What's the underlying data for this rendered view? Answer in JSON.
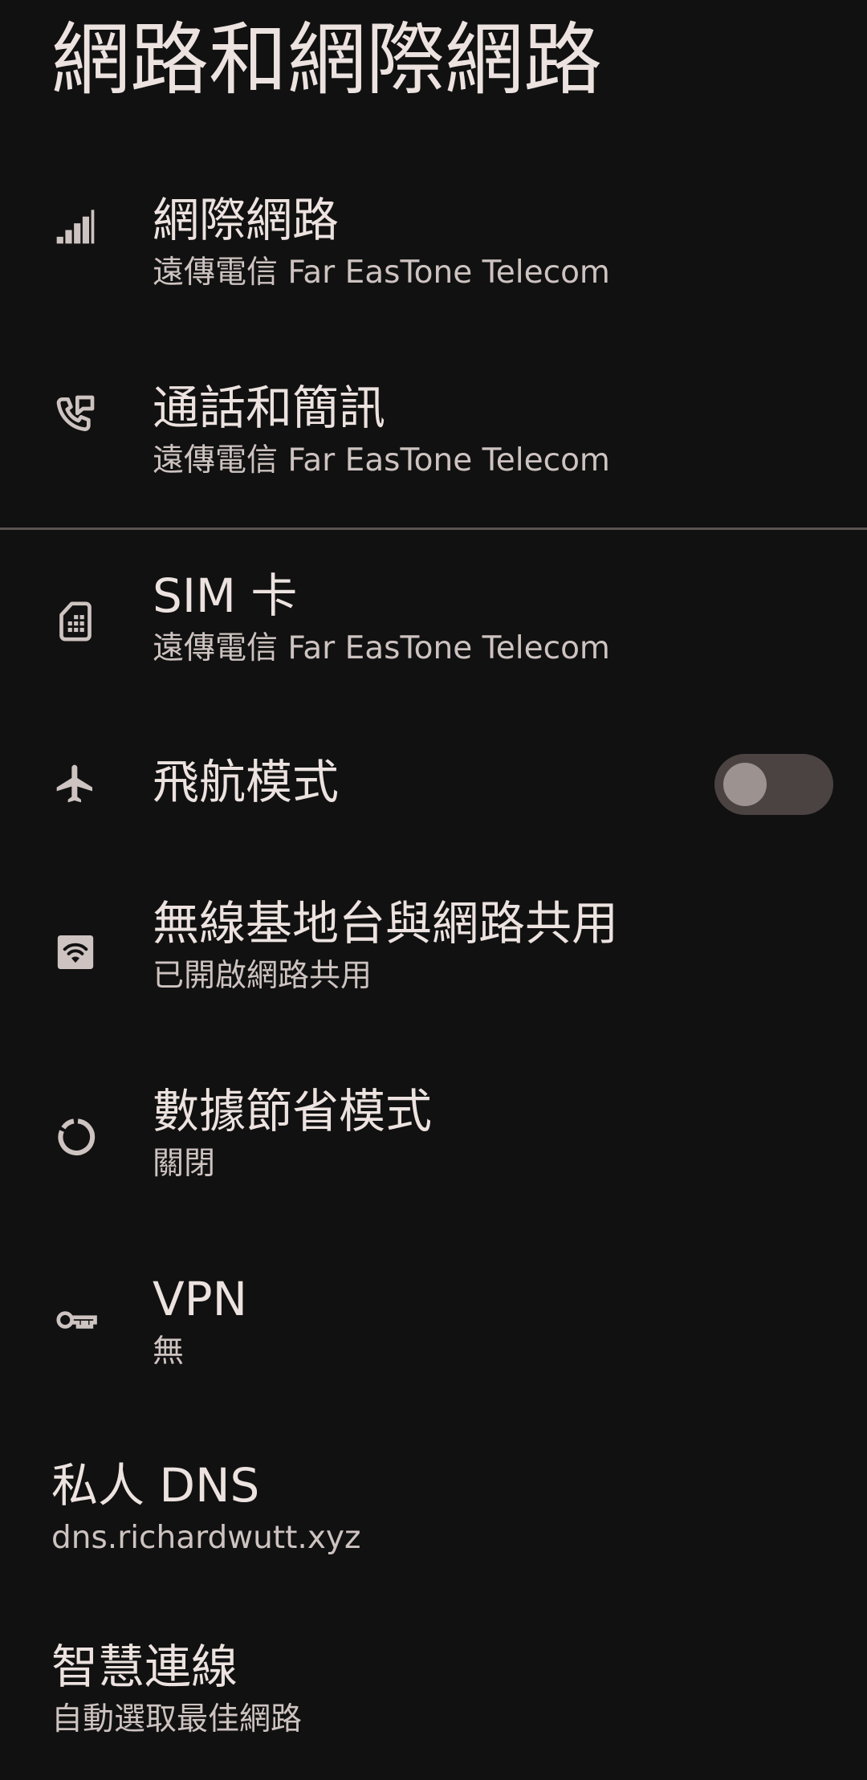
{
  "page": {
    "title": "網路和網際網路"
  },
  "items": [
    {
      "title": "網際網路",
      "summary": "遠傳電信 Far EasTone Telecom",
      "icon": "signal-bars-icon"
    },
    {
      "title": "通話和簡訊",
      "summary": "遠傳電信 Far EasTone Telecom",
      "icon": "call-message-icon"
    },
    {
      "title": "SIM 卡",
      "summary": "遠傳電信 Far EasTone Telecom",
      "icon": "sim-card-icon"
    },
    {
      "title": "飛航模式",
      "icon": "airplane-icon",
      "toggle": {
        "state": "off"
      }
    },
    {
      "title": "無線基地台與網路共用",
      "summary": "已開啟網路共用",
      "icon": "hotspot-icon"
    },
    {
      "title": "數據節省模式",
      "summary": "關閉",
      "icon": "data-saver-icon"
    },
    {
      "title": "VPN",
      "summary": "無",
      "icon": "key-icon"
    },
    {
      "title": "私人 DNS",
      "summary": "dns.richardwutt.xyz"
    },
    {
      "title": "智慧連線",
      "summary": "自動選取最佳網路"
    }
  ],
  "colors": {
    "background": "#111111",
    "text_primary": "#ece2df",
    "text_secondary": "#cdc3c0",
    "divider": "#5a5352",
    "toggle_track_off": "#4b4342",
    "toggle_thumb_off": "#9c9290"
  }
}
